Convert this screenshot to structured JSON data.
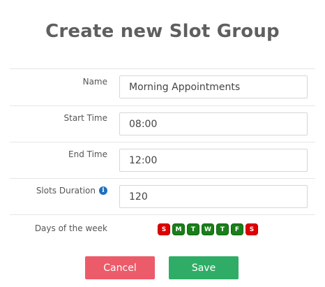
{
  "dialog": {
    "title": "Create new Slot Group"
  },
  "form": {
    "name_label": "Name",
    "name_value": "Morning Appointments",
    "start_label": "Start Time",
    "start_value": "08:00",
    "end_label": "End Time",
    "end_value": "12:00",
    "duration_label": "Slots Duration",
    "duration_value": "120",
    "days_label": "Days of the week",
    "days": [
      {
        "letter": "S",
        "selected": false
      },
      {
        "letter": "M",
        "selected": true
      },
      {
        "letter": "T",
        "selected": true
      },
      {
        "letter": "W",
        "selected": true
      },
      {
        "letter": "T",
        "selected": true
      },
      {
        "letter": "F",
        "selected": true
      },
      {
        "letter": "S",
        "selected": false
      }
    ],
    "info_icon": "info-icon"
  },
  "actions": {
    "cancel_label": "Cancel",
    "save_label": "Save"
  },
  "colors": {
    "cancel": "#ec5b69",
    "save": "#2fad66",
    "day_selected": "#1a7f1a",
    "day_unselected": "#e00000",
    "info": "#1f6fbf"
  }
}
